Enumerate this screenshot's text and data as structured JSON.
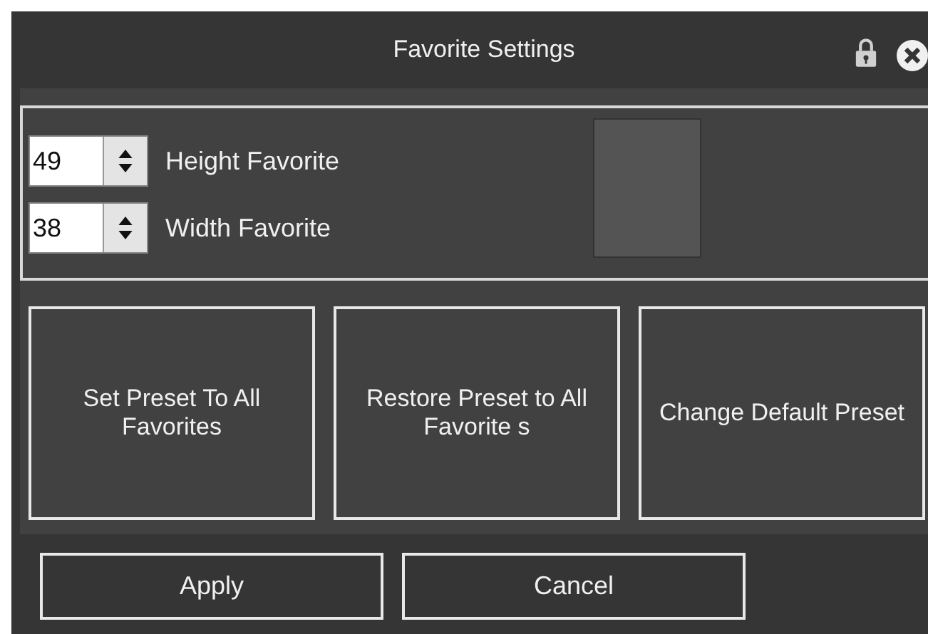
{
  "window": {
    "title": "Favorite Settings"
  },
  "spinners": [
    {
      "value": "49",
      "label": "Height Favorite"
    },
    {
      "value": "38",
      "label": "Width Favorite"
    }
  ],
  "preset_buttons": [
    "Set Preset To All Favorites",
    "Restore Preset to All Favorite s",
    "Change Default Preset"
  ],
  "buttons": [
    "Apply",
    "Cancel"
  ]
}
